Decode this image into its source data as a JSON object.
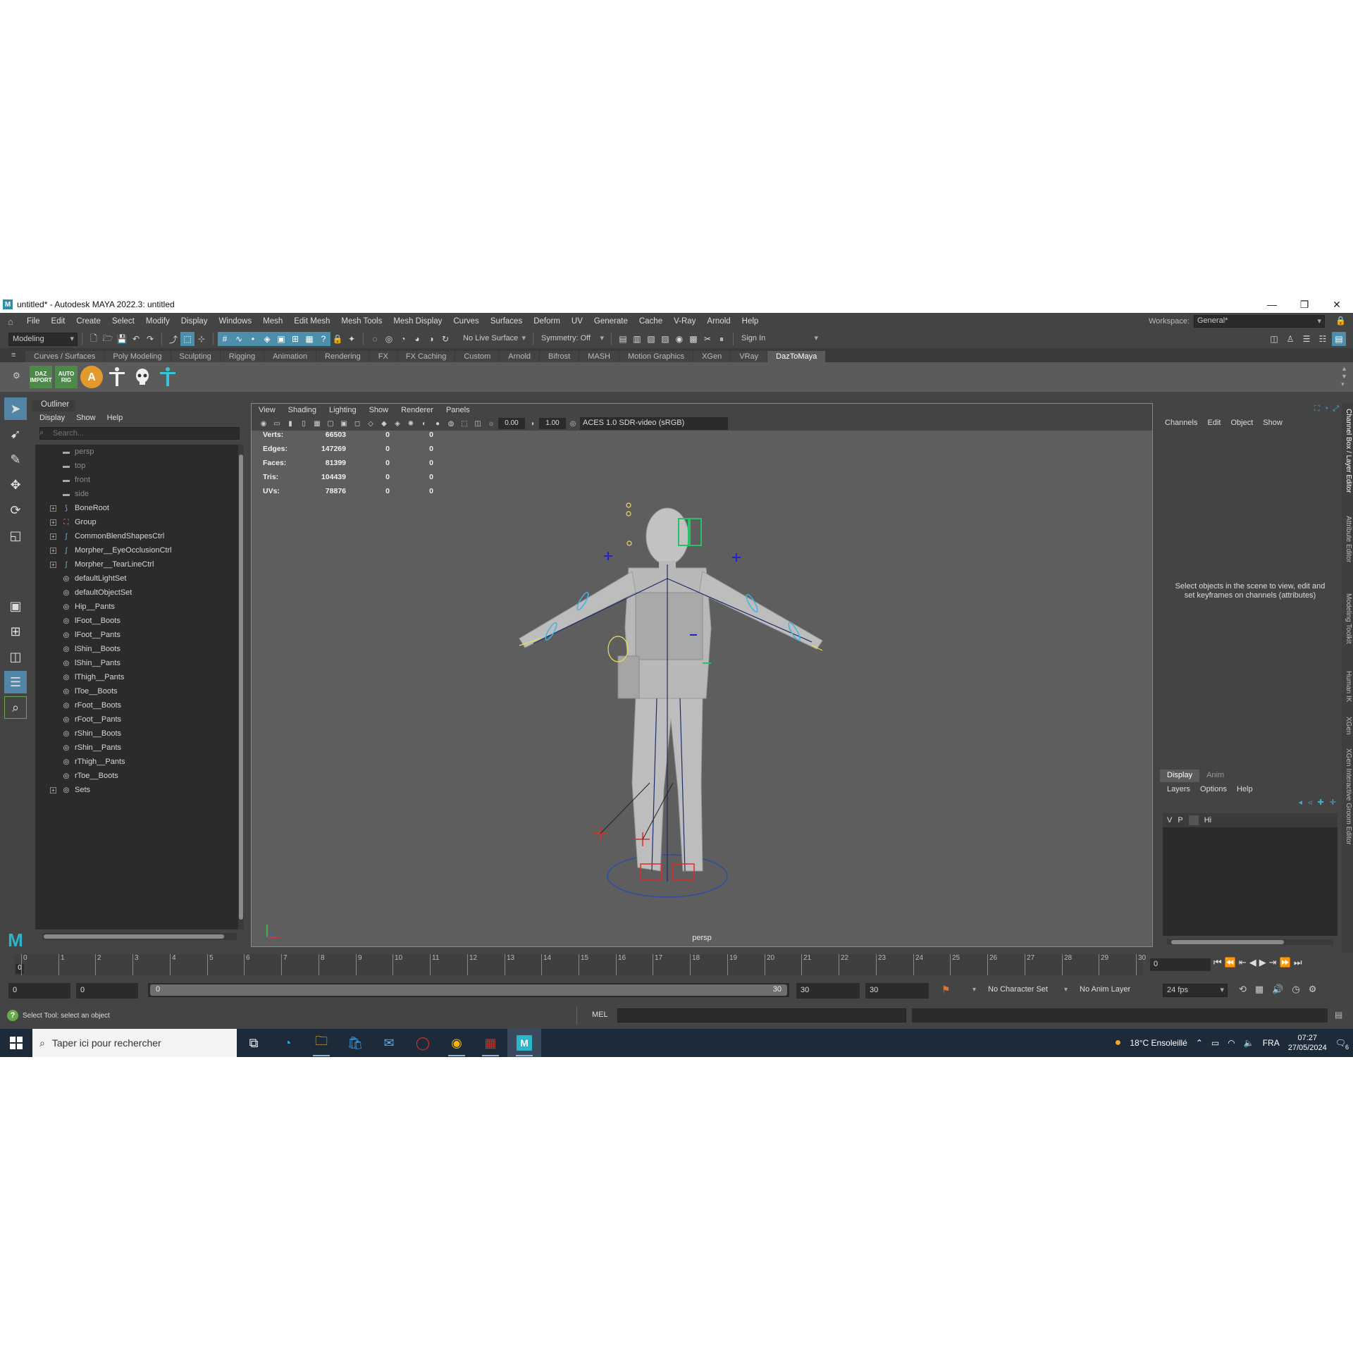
{
  "window": {
    "title": "untitled* - Autodesk MAYA 2022.3: untitled",
    "minimize": "—",
    "restore": "❐",
    "close": "✕"
  },
  "menubar": {
    "items": [
      "File",
      "Edit",
      "Create",
      "Select",
      "Modify",
      "Display",
      "Windows",
      "Mesh",
      "Edit Mesh",
      "Mesh Tools",
      "Mesh Display",
      "Curves",
      "Surfaces",
      "Deform",
      "UV",
      "Generate",
      "Cache",
      "V-Ray",
      "Arnold",
      "Help"
    ],
    "workspace_label": "Workspace:",
    "workspace_value": "General*"
  },
  "statusline": {
    "mode": "Modeling",
    "live_surface": "No Live Surface",
    "symmetry": "Symmetry: Off",
    "sign_in": "Sign In"
  },
  "shelf": {
    "tabs": [
      "Curves / Surfaces",
      "Poly Modeling",
      "Sculpting",
      "Rigging",
      "Animation",
      "Rendering",
      "FX",
      "FX Caching",
      "Custom",
      "Arnold",
      "Bifrost",
      "MASH",
      "Motion Graphics",
      "XGen",
      "VRay",
      "DazToMaya"
    ],
    "active_tab": "DazToMaya",
    "icons": [
      {
        "name": "daz-import-icon",
        "label": "DAZ IMPORT"
      },
      {
        "name": "auto-rig-icon",
        "label": "AUTO RIG"
      },
      {
        "name": "a-pose-icon",
        "label": "A"
      },
      {
        "name": "t-pose-figure-icon",
        "label": ""
      },
      {
        "name": "skull-icon",
        "label": ""
      },
      {
        "name": "cyan-figure-icon",
        "label": ""
      }
    ]
  },
  "outliner": {
    "title": "Outliner",
    "menu": [
      "Display",
      "Show",
      "Help"
    ],
    "search_placeholder": "Search...",
    "items": [
      {
        "label": "persp",
        "kind": "camera",
        "expandable": false
      },
      {
        "label": "top",
        "kind": "camera",
        "expandable": false
      },
      {
        "label": "front",
        "kind": "camera",
        "expandable": false
      },
      {
        "label": "side",
        "kind": "camera",
        "expandable": false
      },
      {
        "label": "BoneRoot",
        "kind": "joint",
        "expandable": true
      },
      {
        "label": "Group",
        "kind": "group",
        "expandable": true
      },
      {
        "label": "CommonBlendShapesCtrl",
        "kind": "curve",
        "expandable": true
      },
      {
        "label": "Morpher__EyeOcclusionCtrl",
        "kind": "curve",
        "expandable": true
      },
      {
        "label": "Morpher__TearLineCtrl",
        "kind": "curve",
        "expandable": true
      },
      {
        "label": "defaultLightSet",
        "kind": "set",
        "expandable": false
      },
      {
        "label": "defaultObjectSet",
        "kind": "set",
        "expandable": false
      },
      {
        "label": "Hip__Pants",
        "kind": "set",
        "expandable": false
      },
      {
        "label": "lFoot__Boots",
        "kind": "set",
        "expandable": false
      },
      {
        "label": "lFoot__Pants",
        "kind": "set",
        "expandable": false
      },
      {
        "label": "lShin__Boots",
        "kind": "set",
        "expandable": false
      },
      {
        "label": "lShin__Pants",
        "kind": "set",
        "expandable": false
      },
      {
        "label": "lThigh__Pants",
        "kind": "set",
        "expandable": false
      },
      {
        "label": "lToe__Boots",
        "kind": "set",
        "expandable": false
      },
      {
        "label": "rFoot__Boots",
        "kind": "set",
        "expandable": false
      },
      {
        "label": "rFoot__Pants",
        "kind": "set",
        "expandable": false
      },
      {
        "label": "rShin__Boots",
        "kind": "set",
        "expandable": false
      },
      {
        "label": "rShin__Pants",
        "kind": "set",
        "expandable": false
      },
      {
        "label": "rThigh__Pants",
        "kind": "set",
        "expandable": false
      },
      {
        "label": "rToe__Boots",
        "kind": "set",
        "expandable": false
      },
      {
        "label": "Sets",
        "kind": "set",
        "expandable": true
      }
    ]
  },
  "viewport": {
    "menu": [
      "View",
      "Shading",
      "Lighting",
      "Show",
      "Renderer",
      "Panels"
    ],
    "exposure": "0.00",
    "gamma": "1.00",
    "color_space": "ACES 1.0 SDR-video (sRGB)",
    "camera": "persp",
    "hud": [
      {
        "label": "Verts:",
        "value": "66503",
        "a": "0",
        "b": "0"
      },
      {
        "label": "Edges:",
        "value": "147269",
        "a": "0",
        "b": "0"
      },
      {
        "label": "Faces:",
        "value": "81399",
        "a": "0",
        "b": "0"
      },
      {
        "label": "Tris:",
        "value": "104439",
        "a": "0",
        "b": "0"
      },
      {
        "label": "UVs:",
        "value": "78876",
        "a": "0",
        "b": "0"
      }
    ]
  },
  "channelbox": {
    "menu": [
      "Channels",
      "Edit",
      "Object",
      "Show"
    ],
    "message": "Select objects in the scene to view, edit and set keyframes on channels (attributes)"
  },
  "layereditor": {
    "tabs": [
      "Display",
      "Anim"
    ],
    "menu": [
      "Layers",
      "Options",
      "Help"
    ],
    "row": {
      "v": "V",
      "p": "P",
      "name": "Hi"
    }
  },
  "sidetabs": [
    "Channel Box / Layer Editor",
    "Attribute Editor",
    "Modeling Toolkit",
    "Human IK",
    "XGen",
    "XGen Interactive Groom Editor"
  ],
  "timeslider": {
    "ticks": [
      "0",
      "1",
      "2",
      "3",
      "4",
      "5",
      "6",
      "7",
      "8",
      "9",
      "10",
      "11",
      "12",
      "13",
      "14",
      "15",
      "16",
      "17",
      "18",
      "19",
      "20",
      "21",
      "22",
      "23",
      "24",
      "25",
      "26",
      "27",
      "28",
      "29",
      "30"
    ],
    "current_frame": "0",
    "playhead": "0"
  },
  "rangeslider": {
    "start": "0",
    "inner_start": "0",
    "range_start": "0",
    "range_end": "30",
    "end": "30",
    "anim_end": "30",
    "character_set": "No Character Set",
    "anim_layer": "No Anim Layer",
    "fps": "24 fps"
  },
  "cmdline": {
    "help": "Select Tool: select an object",
    "mel": "MEL"
  },
  "taskbar": {
    "search_placeholder": "Taper ici pour rechercher",
    "weather": "18°C  Ensoleillé",
    "language": "FRA",
    "time": "07:27",
    "date": "27/05/2024",
    "notifications": "6"
  }
}
